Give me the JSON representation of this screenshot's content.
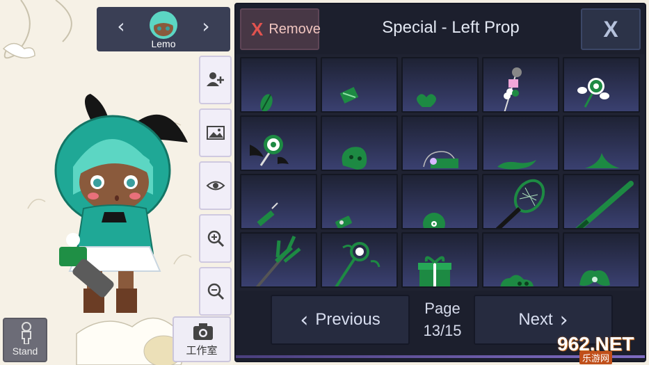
{
  "character_bar": {
    "name": "Lemo",
    "prev_icon": "chevron-left-icon",
    "next_icon": "chevron-right-icon"
  },
  "side_tools": [
    {
      "name": "add-character-button",
      "icon": "add-person-icon"
    },
    {
      "name": "background-button",
      "icon": "image-icon"
    },
    {
      "name": "visibility-button",
      "icon": "eye-icon"
    },
    {
      "name": "zoom-in-button",
      "icon": "zoom-in-icon"
    },
    {
      "name": "zoom-out-button",
      "icon": "zoom-out-icon"
    }
  ],
  "bottom_left": {
    "stand_label": "Stand",
    "studio_label": "工作室",
    "studio_icon": "camera-icon"
  },
  "panel": {
    "remove_x": "X",
    "remove_label": "Remove",
    "title": "Special - Left Prop",
    "close_label": "X",
    "items": [
      {
        "icon": "green-leaf-prop-icon"
      },
      {
        "icon": "green-box-prop-icon"
      },
      {
        "icon": "green-heart-prop-icon"
      },
      {
        "icon": "cat-skewer-prop-icon"
      },
      {
        "icon": "winged-lollipop-prop-icon"
      },
      {
        "icon": "bat-lollipop-prop-icon"
      },
      {
        "icon": "green-mask-prop-icon"
      },
      {
        "icon": "flower-purse-prop-icon"
      },
      {
        "icon": "green-lizard-prop-icon"
      },
      {
        "icon": "green-fin-prop-icon"
      },
      {
        "icon": "green-syringe-prop-icon"
      },
      {
        "icon": "green-phone-prop-icon"
      },
      {
        "icon": "green-disc-prop-icon"
      },
      {
        "icon": "tennis-racket-prop-icon"
      },
      {
        "icon": "baseball-bat-prop-icon"
      },
      {
        "icon": "trident-prop-icon"
      },
      {
        "icon": "magic-wand-prop-icon"
      },
      {
        "icon": "gift-box-prop-icon"
      },
      {
        "icon": "green-slime-prop-icon"
      },
      {
        "icon": "green-bow-prop-icon"
      }
    ],
    "previous_label": "Previous",
    "next_label": "Next",
    "page_label": "Page",
    "page_value": "13/15"
  },
  "watermark": {
    "number": "962.NET",
    "sub": "乐游网"
  },
  "colors": {
    "panel_bg": "#1f2231",
    "cell_top": "#1e2234",
    "cell_bottom": "#3a4070",
    "prop_green": "#1d8a43",
    "remove_red": "#e0534f"
  }
}
